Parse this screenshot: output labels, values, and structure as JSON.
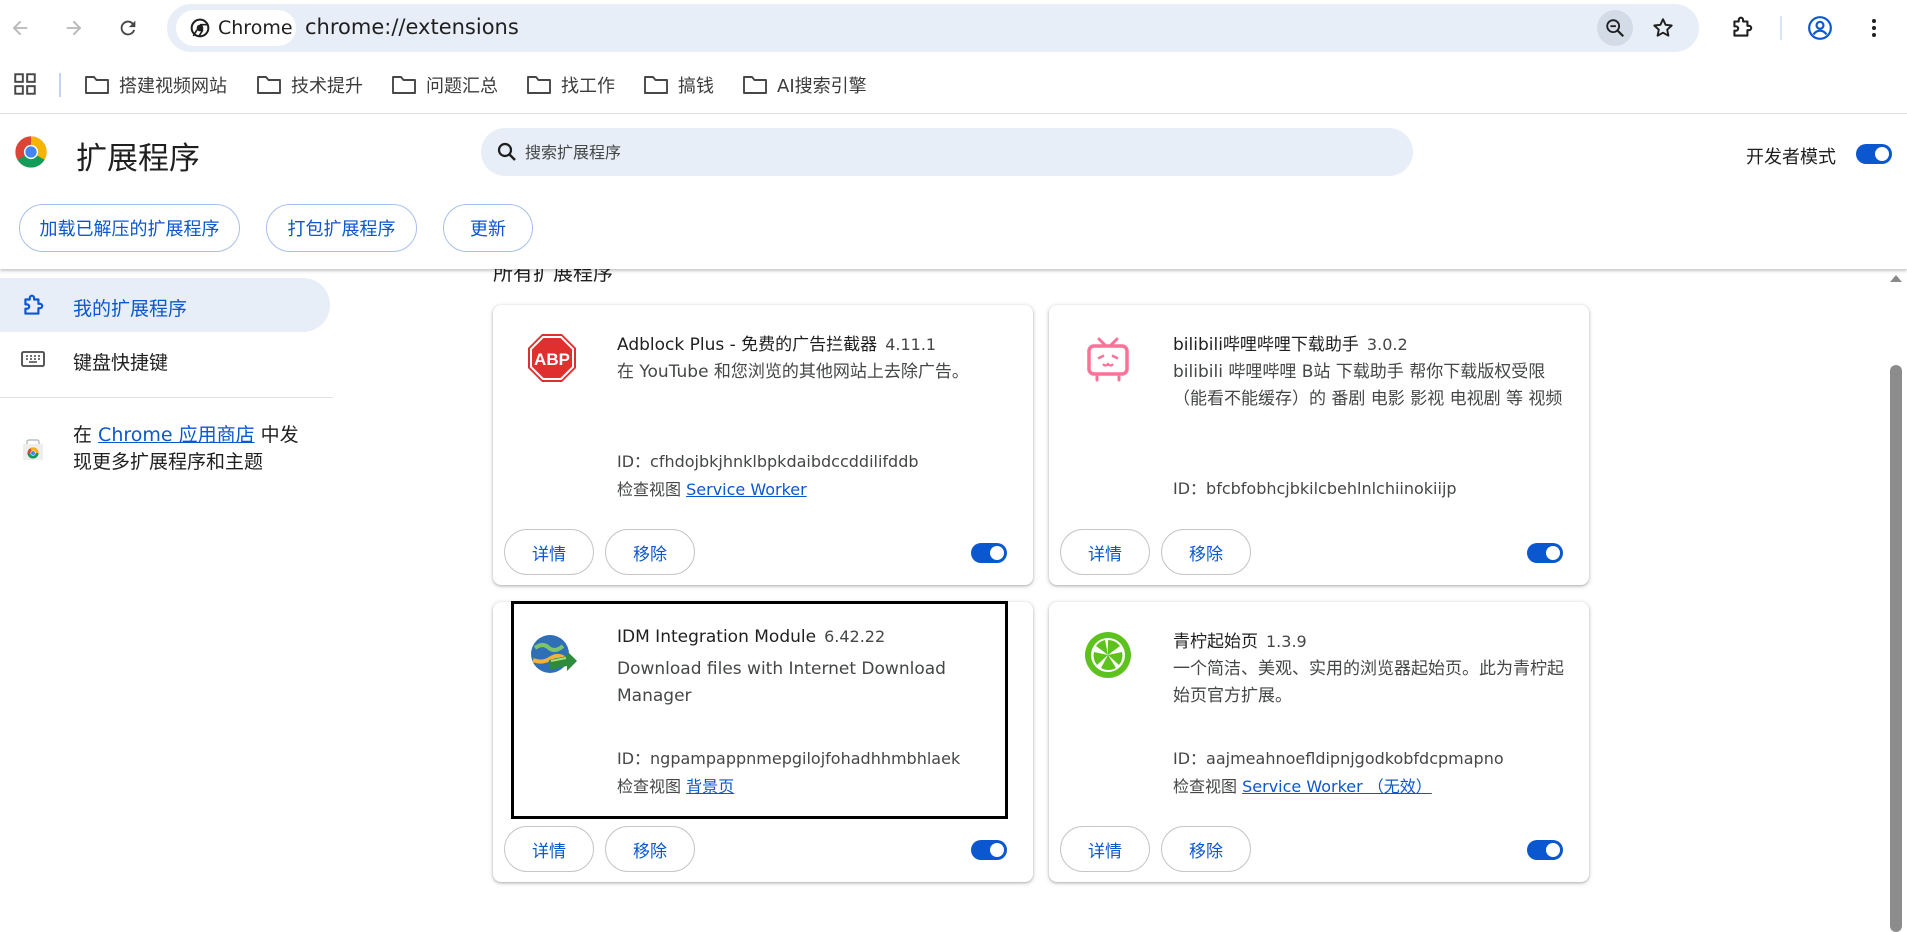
{
  "browser": {
    "chip_label": "Chrome",
    "url": "chrome://extensions",
    "icons": [
      "back-icon",
      "forward-icon",
      "reload-icon",
      "zoom-icon",
      "star-icon",
      "extensions-puzzle-icon",
      "profile-icon",
      "kebab-menu-icon"
    ]
  },
  "bookmarks": {
    "items": [
      {
        "label": "搭建视频网站"
      },
      {
        "label": "技术提升"
      },
      {
        "label": "问题汇总"
      },
      {
        "label": "找工作"
      },
      {
        "label": "搞钱"
      },
      {
        "label": "AI搜索引擎"
      }
    ]
  },
  "header": {
    "title": "扩展程序",
    "search_placeholder": "搜索扩展程序",
    "dev_mode_label": "开发者模式",
    "dev_mode_on": true,
    "buttons": {
      "load_unpacked": "加载已解压的扩展程序",
      "pack": "打包扩展程序",
      "update": "更新"
    }
  },
  "sidebar": {
    "items": [
      {
        "label": "我的扩展程序",
        "active": true
      },
      {
        "label": "键盘快捷键",
        "active": false
      }
    ],
    "store_prefix": "在 ",
    "store_link": "Chrome 应用商店",
    "store_suffix": " 中发现更多扩展程序和主题"
  },
  "main": {
    "section_title": "所有扩展程序",
    "extensions": [
      {
        "name": "Adblock Plus - 免费的广告拦截器",
        "version": "4.11.1",
        "description": "在 YouTube 和您浏览的其他网站上去除广告。",
        "id": "ID：cfhdojbkjhnklbpkdaibdccddilifddb",
        "inspect_label": "检查视图",
        "inspect_link": "Service Worker",
        "enabled": true,
        "details_label": "详情",
        "remove_label": "移除",
        "icon": "adblock-plus-icon",
        "icon_color": "#e02f2f"
      },
      {
        "name": "bilibili哔哩哔哩下载助手",
        "version": "3.0.2",
        "description": "bilibili 哔哩哔哩 B站 下载助手 帮你下载版权受限（能看不能缓存）的 番剧 电影 影视 电视剧 等 视频",
        "id": "ID：bfcbfobhcjbkilcbehlnlchiinokiijp",
        "inspect_label": "",
        "inspect_link": "",
        "enabled": true,
        "details_label": "详情",
        "remove_label": "移除",
        "icon": "bilibili-tv-icon",
        "icon_color": "#fb7299"
      },
      {
        "name": "IDM Integration Module",
        "version": "6.42.22",
        "description": "Download files with Internet Download Manager",
        "id": "ID：ngpampappnmepgilojfohadhhmbhlaek",
        "inspect_label": "检查视图",
        "inspect_link": "背景页",
        "enabled": true,
        "details_label": "详情",
        "remove_label": "移除",
        "icon": "idm-globe-icon",
        "icon_color": "#2e8b3e"
      },
      {
        "name": "青柠起始页",
        "version": "1.3.9",
        "description": "一个简洁、美观、实用的浏览器起始页。此为青柠起始页官方扩展。",
        "id": "ID：aajmeahnoefldipnjgodkobfdcpmapno",
        "inspect_label": "检查视图",
        "inspect_link": "Service Worker （无效）",
        "enabled": true,
        "details_label": "详情",
        "remove_label": "移除",
        "icon": "lime-slice-icon",
        "icon_color": "#5dc21e"
      }
    ]
  },
  "colors": {
    "accent": "#0b57d0",
    "omnibox_bg": "#e8eef7",
    "card_shadow": "#c4c7c5"
  }
}
